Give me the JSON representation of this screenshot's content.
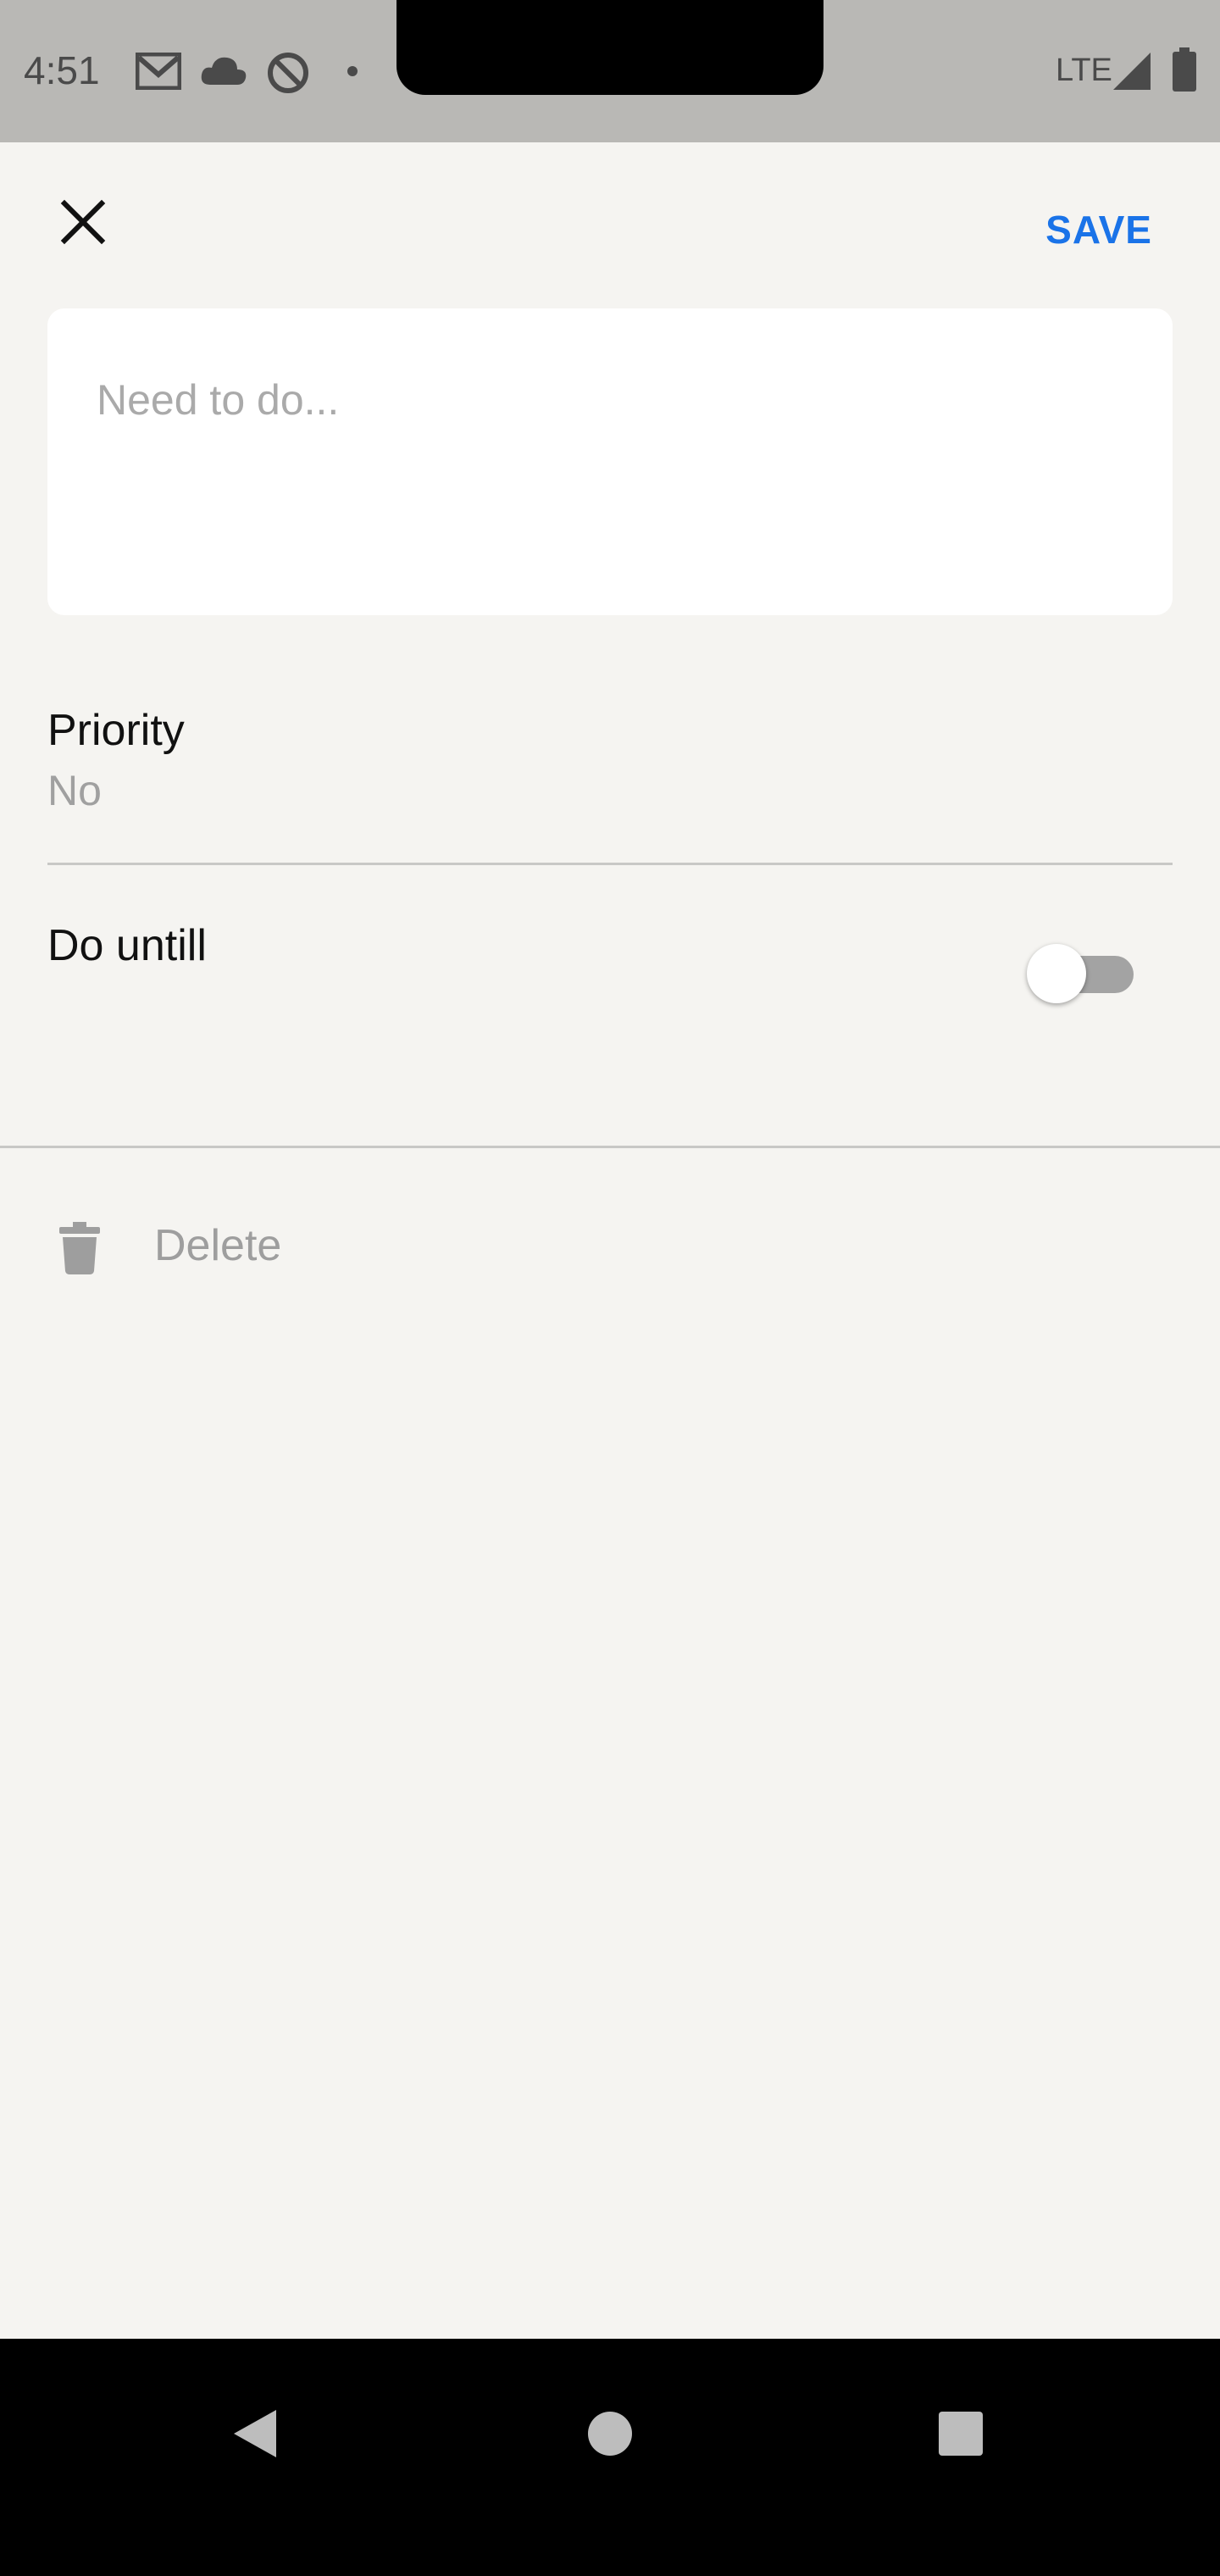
{
  "status_bar": {
    "time": "4:51",
    "icons": [
      "gmail-icon",
      "cloud-icon",
      "do-not-disturb-icon",
      "dot-icon"
    ],
    "network": "LTE",
    "signal_icon": "signal-icon",
    "battery_icon": "battery-icon"
  },
  "toolbar": {
    "close_icon": "close-icon",
    "save_label": "SAVE",
    "accent_color": "#1a73e8"
  },
  "task": {
    "placeholder": "Need to do...",
    "value": ""
  },
  "priority": {
    "label": "Priority",
    "value": "No"
  },
  "do_until": {
    "label": "Do untill",
    "enabled": false
  },
  "delete": {
    "icon": "trash-icon",
    "label": "Delete"
  },
  "nav_bar": {
    "buttons": [
      "back-icon",
      "home-icon",
      "recents-icon"
    ]
  }
}
